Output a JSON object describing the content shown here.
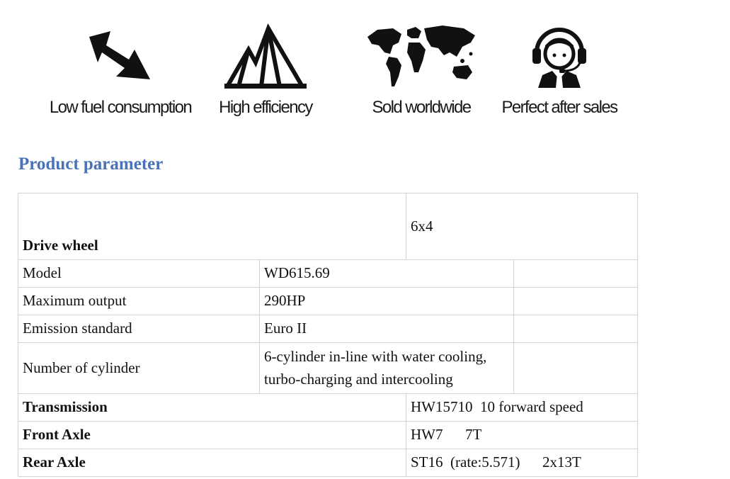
{
  "features": [
    {
      "icon": "arrow-down-right-icon",
      "label": "Low fuel consumption"
    },
    {
      "icon": "mountain-peaks-icon",
      "label": "High efficiency"
    },
    {
      "icon": "world-map-icon",
      "label": "Sold worldwide"
    },
    {
      "icon": "headset-agent-icon",
      "label": "Perfect after sales"
    }
  ],
  "section_title": "Product parameter",
  "colors": {
    "title": "#4a72b8",
    "border": "#d4d4d4"
  },
  "table": {
    "drive_wheel": {
      "label": "Drive wheel",
      "value": "6x4"
    },
    "engine_rows": [
      {
        "label": "Model",
        "value": "WD615.69"
      },
      {
        "label": "Maximum output",
        "value": "290HP"
      },
      {
        "label": "Emission standard",
        "value": "Euro II"
      },
      {
        "label": "Number of cylinder",
        "value_line1": "6-cylinder in-line with water cooling,",
        "value_line2": "turbo-charging and intercooling"
      }
    ],
    "transmission": {
      "label": "Transmission",
      "value": "HW15710  10 forward speed"
    },
    "front_axle": {
      "label": "Front Axle",
      "value": "HW7      7T"
    },
    "rear_axle": {
      "label": "Rear Axle",
      "value": "ST16  (rate:5.571)      2x13T"
    }
  }
}
